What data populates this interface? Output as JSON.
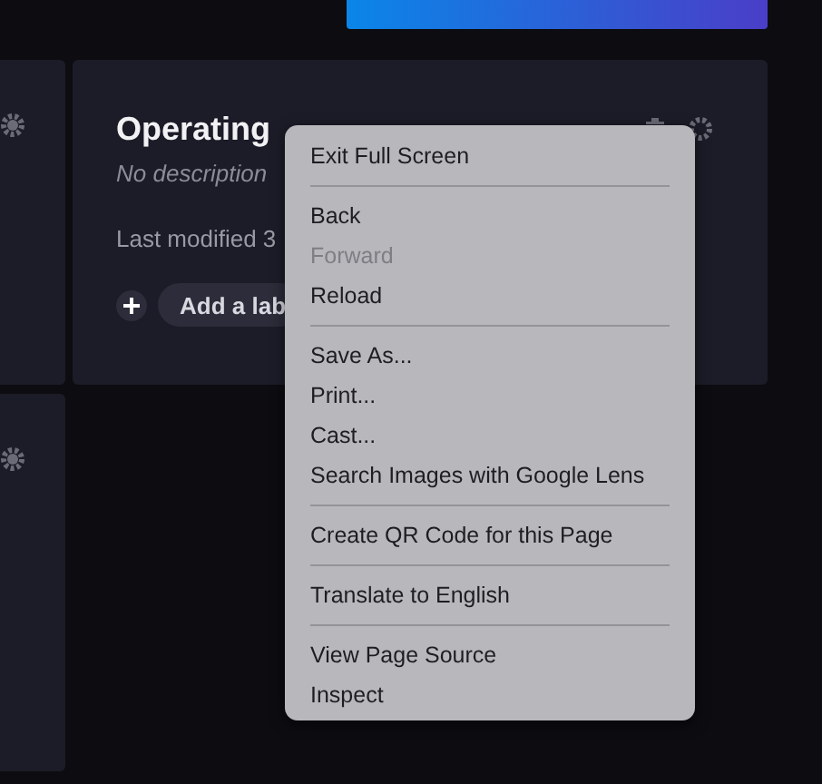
{
  "cards": [
    {
      "title": "Operating",
      "description": "No description",
      "modified": "Last modified 3",
      "add_label": "Add a lab"
    }
  ],
  "context_menu": {
    "groups": [
      [
        {
          "label": "Exit Full Screen",
          "disabled": false
        }
      ],
      [
        {
          "label": "Back",
          "disabled": false
        },
        {
          "label": "Forward",
          "disabled": true
        },
        {
          "label": "Reload",
          "disabled": false
        }
      ],
      [
        {
          "label": "Save As...",
          "disabled": false
        },
        {
          "label": "Print...",
          "disabled": false
        },
        {
          "label": "Cast...",
          "disabled": false
        },
        {
          "label": "Search Images with Google Lens",
          "disabled": false
        }
      ],
      [
        {
          "label": "Create QR Code for this Page",
          "disabled": false
        }
      ],
      [
        {
          "label": "Translate to English",
          "disabled": false
        }
      ],
      [
        {
          "label": "View Page Source",
          "disabled": false
        },
        {
          "label": "Inspect",
          "disabled": false
        }
      ]
    ]
  }
}
